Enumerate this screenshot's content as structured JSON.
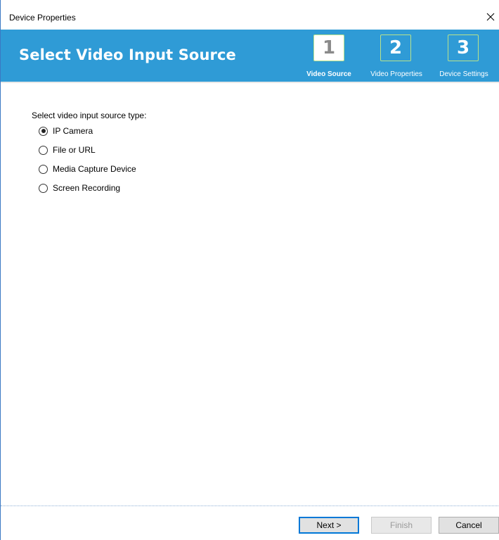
{
  "window": {
    "title": "Device Properties"
  },
  "header": {
    "heading": "Select Video Input Source",
    "steps": [
      {
        "number": "1",
        "label": "Video Source",
        "active": true
      },
      {
        "number": "2",
        "label": "Video Properties",
        "active": false
      },
      {
        "number": "3",
        "label": "Device Settings",
        "active": false
      }
    ]
  },
  "form": {
    "prompt": "Select video input source type:",
    "options": [
      {
        "label": "IP Camera",
        "selected": true
      },
      {
        "label": "File or URL",
        "selected": false
      },
      {
        "label": "Media Capture Device",
        "selected": false
      },
      {
        "label": "Screen Recording",
        "selected": false
      }
    ]
  },
  "buttons": {
    "next": "Next >",
    "finish": "Finish",
    "cancel": "Cancel"
  },
  "colors": {
    "header_bg": "#2f9bd6",
    "step_border": "#b8e28b",
    "window_border": "#3b79c4"
  },
  "icons": {
    "close": "close-icon"
  }
}
